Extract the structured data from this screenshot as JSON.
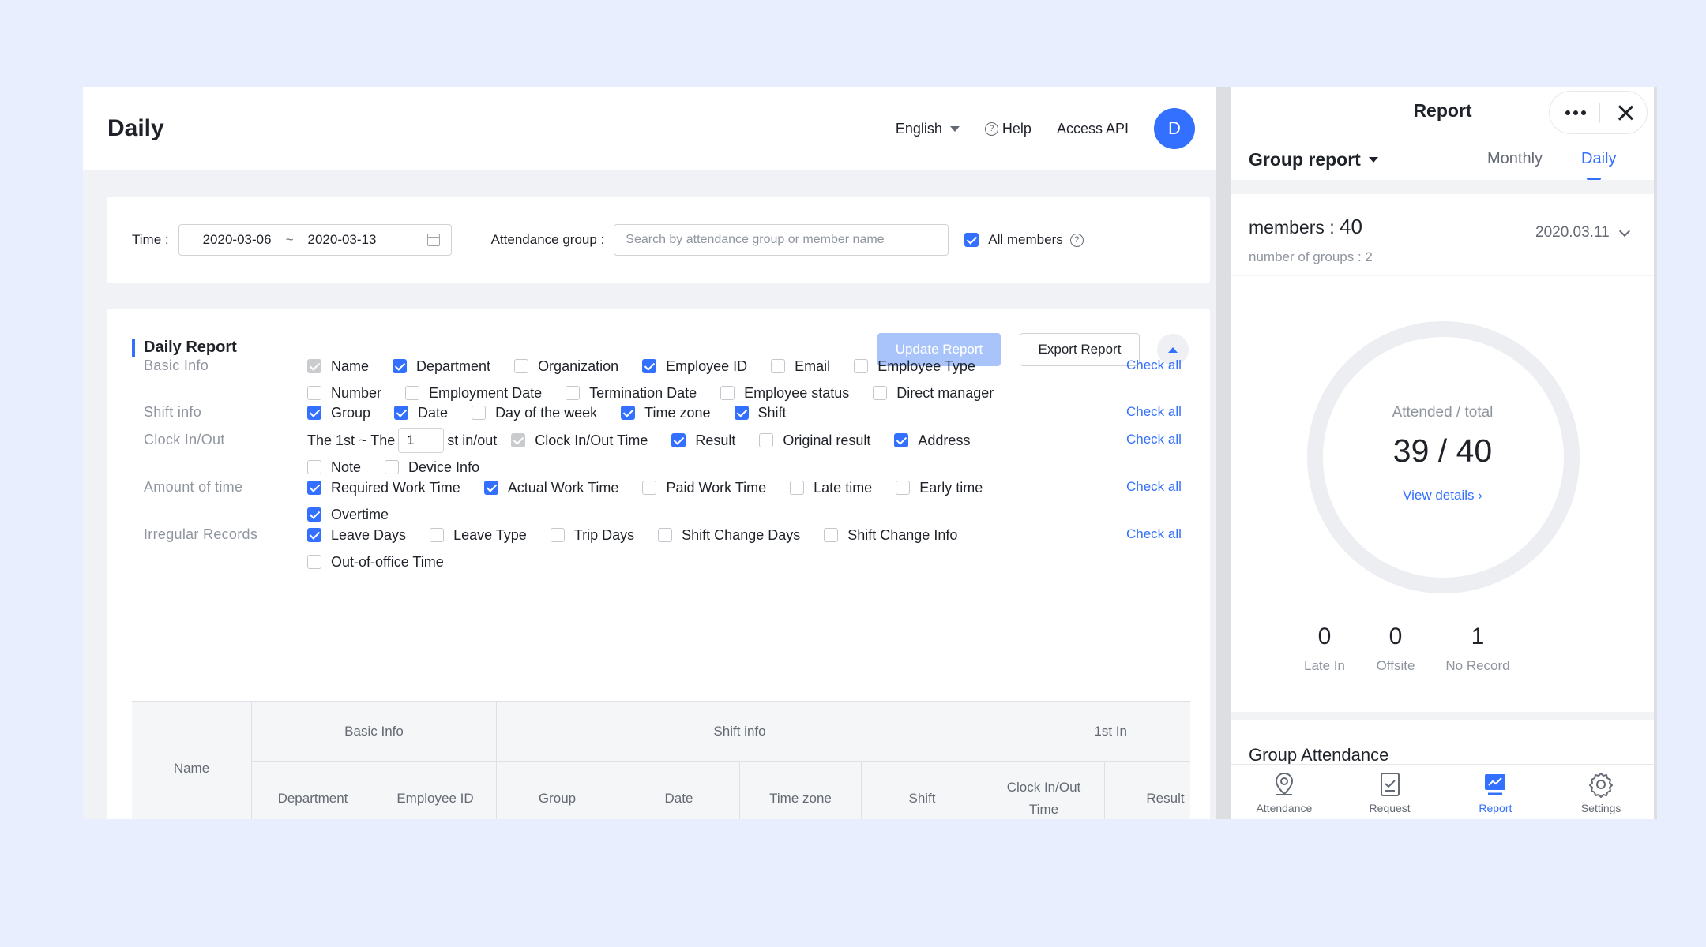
{
  "left": {
    "title": "Daily",
    "topbar": {
      "language": "English",
      "help": "Help",
      "access_api": "Access API",
      "avatar_initial": "D"
    },
    "filter": {
      "time_label": "Time :",
      "date_start": "2020-03-06",
      "date_sep": "~",
      "date_end": "2020-03-13",
      "group_label": "Attendance group :",
      "group_placeholder": "Search by attendance group or member name",
      "all_members_label": "All members",
      "all_members_checked": true
    },
    "report": {
      "title": "Daily Report",
      "update_label": "Update Report",
      "export_label": "Export Report",
      "check_all_label": "Check all",
      "sections": [
        {
          "label": "Basic Info",
          "lines": [
            [
              {
                "label": "Name",
                "state": "disabled"
              },
              {
                "label": "Department",
                "state": "on"
              },
              {
                "label": "Organization",
                "state": "off"
              },
              {
                "label": "Employee ID",
                "state": "on"
              },
              {
                "label": "Email",
                "state": "off"
              },
              {
                "label": "Employee Type",
                "state": "off"
              }
            ],
            [
              {
                "label": "Number",
                "state": "off"
              },
              {
                "label": "Employment Date",
                "state": "off"
              },
              {
                "label": "Termination Date",
                "state": "off"
              },
              {
                "label": "Employee status",
                "state": "off"
              },
              {
                "label": "Direct manager",
                "state": "off"
              }
            ]
          ]
        },
        {
          "label": "Shift info",
          "lines": [
            [
              {
                "label": "Group",
                "state": "on"
              },
              {
                "label": "Date",
                "state": "on"
              },
              {
                "label": "Day of the week",
                "state": "off"
              },
              {
                "label": "Time zone",
                "state": "on"
              },
              {
                "label": "Shift",
                "state": "on"
              }
            ]
          ]
        },
        {
          "label": "Clock In/Out",
          "lines": [
            [
              {
                "label": "Clock In/Out Time",
                "state": "disabled"
              },
              {
                "label": "Result",
                "state": "on"
              },
              {
                "label": "Original result",
                "state": "off"
              },
              {
                "label": "Address",
                "state": "on"
              }
            ],
            [
              {
                "label": "Note",
                "state": "off"
              },
              {
                "label": "Device Info",
                "state": "off"
              }
            ]
          ]
        },
        {
          "label": "Amount of time",
          "lines": [
            [
              {
                "label": "Required Work Time",
                "state": "on"
              },
              {
                "label": "Actual Work Time",
                "state": "on"
              },
              {
                "label": "Paid Work Time",
                "state": "off"
              },
              {
                "label": "Late time",
                "state": "off"
              },
              {
                "label": "Early time",
                "state": "off"
              }
            ],
            [
              {
                "label": "Overtime",
                "state": "on"
              }
            ]
          ]
        },
        {
          "label": "Irregular Records",
          "lines": [
            [
              {
                "label": "Leave Days",
                "state": "on"
              },
              {
                "label": "Leave Type",
                "state": "off"
              },
              {
                "label": "Trip Days",
                "state": "off"
              },
              {
                "label": "Shift Change Days",
                "state": "off"
              },
              {
                "label": "Shift Change Info",
                "state": "off"
              }
            ],
            [
              {
                "label": "Out-of-office Time",
                "state": "off"
              }
            ]
          ]
        }
      ],
      "clock_prefix": "The 1st ~ The",
      "clock_count": "1",
      "clock_suffix": "st in/out"
    },
    "table": {
      "name_header": "Name",
      "group_headers": [
        "Basic Info",
        "Shift info",
        "1st In"
      ],
      "sub_headers": [
        "Department",
        "Employee ID",
        "Group",
        "Date",
        "Time zone",
        "Shift",
        "Clock In/Out Time",
        "Result"
      ]
    }
  },
  "mobile": {
    "title": "Report",
    "group_report": "Group report",
    "tabs": [
      "Monthly",
      "Daily"
    ],
    "active_tab": "Daily",
    "members_label": "members :",
    "members_value": "40",
    "groups_text": "number of groups : 2",
    "date": "2020.03.11",
    "ring_label": "Attended / total",
    "ring_value": "39 / 40",
    "attended": 39,
    "total": 40,
    "view_details": "View details",
    "stats": [
      {
        "value": "0",
        "label": "Late In"
      },
      {
        "value": "0",
        "label": "Offsite"
      },
      {
        "value": "1",
        "label": "No Record"
      }
    ],
    "group_attendance": "Group Attendance",
    "nav": [
      {
        "label": "Attendance",
        "icon": "location-pin-icon"
      },
      {
        "label": "Request",
        "icon": "document-check-icon"
      },
      {
        "label": "Report",
        "icon": "chart-icon"
      },
      {
        "label": "Settings",
        "icon": "gear-icon"
      }
    ],
    "active_nav": "Report"
  },
  "colors": {
    "accent": "#3370ff",
    "background": "#e8eefd",
    "muted": "#8f959e"
  }
}
